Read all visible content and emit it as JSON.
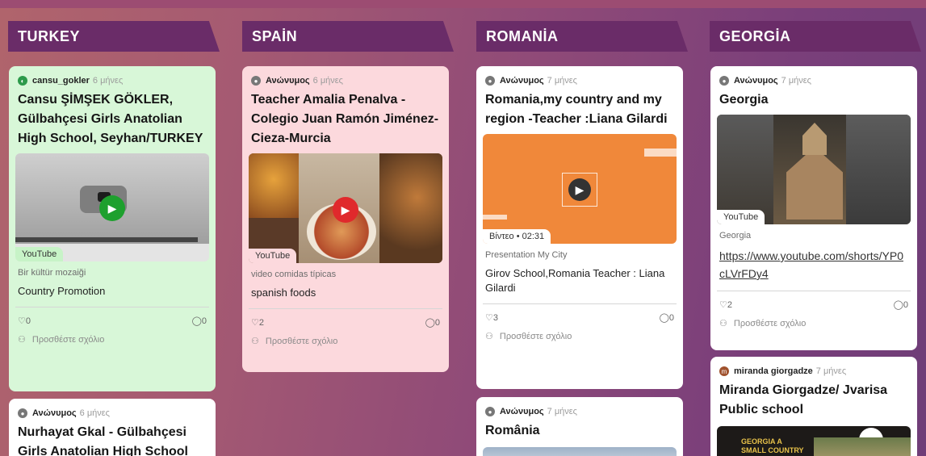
{
  "columns": [
    {
      "title": "TURKEY"
    },
    {
      "title": "SPAİN"
    },
    {
      "title": "ROMANİA"
    },
    {
      "title": "GEORGİA"
    }
  ],
  "cards": {
    "turkey1": {
      "author": "cansu_gokler",
      "time": "6 μήνες",
      "title": "Cansu ŞİMŞEK GÖKLER, Gülbahçesi Girls Anatolian High School, Seyhan/TURKEY",
      "badge": "YouTube",
      "sub": "Bir kültür mozaiği",
      "desc": "Country Promotion",
      "likes": "0",
      "comments": "0",
      "add_comment": "Προσθέστε σχόλιο"
    },
    "turkey2": {
      "author": "Ανώνυμος",
      "time": "6 μήνες",
      "title": "Nurhayat Gkal - Gülbahçesi Girls Anatolian High School"
    },
    "spain1": {
      "author": "Ανώνυμος",
      "time": "6 μήνες",
      "title": "Teacher Amalia Penalva - Colegio Juan Ramón Jiménez-Cieza-Murcia",
      "badge": "YouTube",
      "sub": "video comidas típicas",
      "desc": "spanish foods",
      "likes": "2",
      "comments": "0",
      "add_comment": "Προσθέστε σχόλιο"
    },
    "romania1": {
      "author": "Ανώνυμος",
      "time": "7 μήνες",
      "title": "Romania,my country and my region -Teacher :Liana Gilardi",
      "badge": "Βίντεο • 02:31",
      "sub": "Presentation My City",
      "desc": "Girov School,Romania Teacher : Liana Gilardi",
      "likes": "3",
      "comments": "0",
      "add_comment": "Προσθέστε σχόλιο"
    },
    "romania2": {
      "author": "Ανώνυμος",
      "time": "7 μήνες",
      "title": "România"
    },
    "georgia1": {
      "author": "Ανώνυμος",
      "time": "7 μήνες",
      "title": "Georgia",
      "badge": "YouTube",
      "sub": "Georgia",
      "link": "https://www.youtube.com/shorts/YP0cLVrFDy4",
      "likes": "2",
      "comments": "0",
      "add_comment": "Προσθέστε σχόλιο"
    },
    "georgia2": {
      "author": "miranda giorgadze",
      "time": "7 μήνες",
      "title": "Miranda Giorgadze/ Jvarisa Public school",
      "thumb_text": "GEORGIA A SMALL COUNTRY"
    }
  },
  "icons": {
    "heart": "heart-icon",
    "comment": "comment-icon",
    "person": "person-icon",
    "play": "play-icon",
    "avatar": "avatar"
  },
  "colors": {
    "header": "#6a2c68",
    "green_card": "#d8f7d8",
    "pink_card": "#fcd9dd",
    "white_card": "#ffffff",
    "youtube_red": "#e0292c",
    "orange": "#f08a3c"
  }
}
